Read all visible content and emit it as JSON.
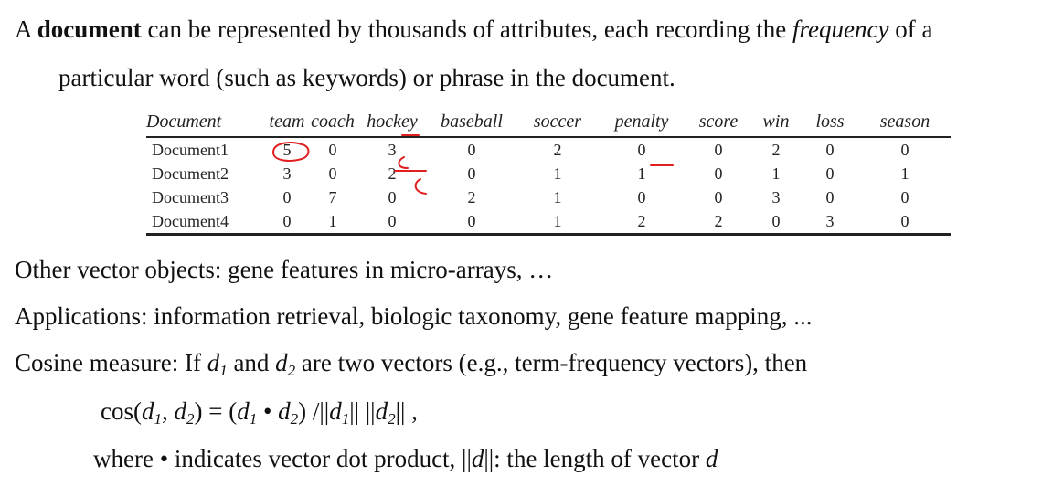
{
  "paragraphs": {
    "line1_prefix": "A ",
    "line1_bold": "document",
    "line1_mid": " can be represented by thousands of attributes, each recording the ",
    "line1_italic": "frequency",
    "line1_suffix": " of a",
    "line2": "particular word (such as keywords) or phrase in the document.",
    "other": "Other vector objects: gene features in micro-arrays, …",
    "applications": "Applications: information retrieval, biologic taxonomy, gene feature mapping, ...",
    "cosine_prefix": "Cosine measure: If ",
    "cosine_d": "d",
    "cosine_sub1": "1",
    "cosine_and": " and ",
    "cosine_sub2": "2",
    "cosine_suffix": " are two vectors (e.g., term-frequency vectors), then",
    "formula_cos": "cos(",
    "formula_d": "d",
    "formula_sub1": "1",
    "formula_sep": ", ",
    "formula_sub2": "2",
    "formula_eq": ") =  (",
    "formula_dot": " • ",
    "formula_div": ") /||",
    "formula_norm_mid": "|| ||",
    "formula_end": "|| ,",
    "where_prefix": "where • indicates vector dot product, ||",
    "where_d": "d",
    "where_mid": "||: the length of vector ",
    "where_end": "d"
  },
  "table": {
    "columns": [
      "Document",
      "team",
      "coach",
      "hockey",
      "baseball",
      "soccer",
      "penalty",
      "score",
      "win",
      "loss",
      "season"
    ],
    "rows": [
      [
        "Document1",
        "5",
        "0",
        "3",
        "0",
        "2",
        "0",
        "0",
        "2",
        "0",
        "0"
      ],
      [
        "Document2",
        "3",
        "0",
        "2",
        "0",
        "1",
        "1",
        "0",
        "1",
        "0",
        "1"
      ],
      [
        "Document3",
        "0",
        "7",
        "0",
        "2",
        "1",
        "0",
        "0",
        "3",
        "0",
        "0"
      ],
      [
        "Document4",
        "0",
        "1",
        "0",
        "0",
        "1",
        "2",
        "2",
        "0",
        "3",
        "0"
      ]
    ]
  },
  "colors": {
    "annotation": "#e02020",
    "text": "#111111"
  }
}
